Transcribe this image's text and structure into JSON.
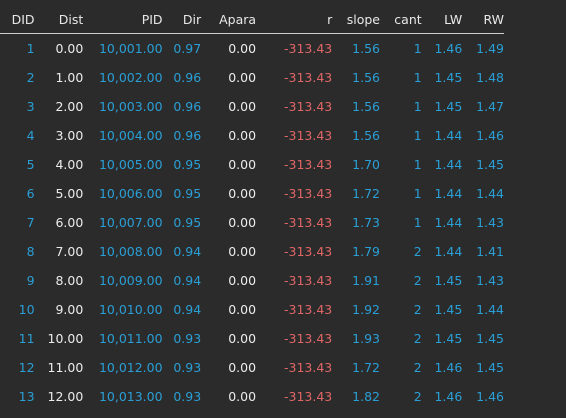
{
  "table": {
    "headers": {
      "did": "DID",
      "dist": "Dist",
      "pid": "PID",
      "dir": "Dir",
      "apara": "Apara",
      "r": "r",
      "slope": "slope",
      "cant": "cant",
      "lw": "LW",
      "rw": "RW"
    },
    "rows": [
      {
        "did": "1",
        "dist": "0.00",
        "pid": "10,001.00",
        "dir": "0.97",
        "apara": "0.00",
        "r": "-313.43",
        "slope": "1.56",
        "cant": "1",
        "lw": "1.46",
        "rw": "1.49"
      },
      {
        "did": "2",
        "dist": "1.00",
        "pid": "10,002.00",
        "dir": "0.96",
        "apara": "0.00",
        "r": "-313.43",
        "slope": "1.56",
        "cant": "1",
        "lw": "1.45",
        "rw": "1.48"
      },
      {
        "did": "3",
        "dist": "2.00",
        "pid": "10,003.00",
        "dir": "0.96",
        "apara": "0.00",
        "r": "-313.43",
        "slope": "1.56",
        "cant": "1",
        "lw": "1.45",
        "rw": "1.47"
      },
      {
        "did": "4",
        "dist": "3.00",
        "pid": "10,004.00",
        "dir": "0.96",
        "apara": "0.00",
        "r": "-313.43",
        "slope": "1.56",
        "cant": "1",
        "lw": "1.44",
        "rw": "1.46"
      },
      {
        "did": "5",
        "dist": "4.00",
        "pid": "10,005.00",
        "dir": "0.95",
        "apara": "0.00",
        "r": "-313.43",
        "slope": "1.70",
        "cant": "1",
        "lw": "1.44",
        "rw": "1.45"
      },
      {
        "did": "6",
        "dist": "5.00",
        "pid": "10,006.00",
        "dir": "0.95",
        "apara": "0.00",
        "r": "-313.43",
        "slope": "1.72",
        "cant": "1",
        "lw": "1.44",
        "rw": "1.44"
      },
      {
        "did": "7",
        "dist": "6.00",
        "pid": "10,007.00",
        "dir": "0.95",
        "apara": "0.00",
        "r": "-313.43",
        "slope": "1.73",
        "cant": "1",
        "lw": "1.44",
        "rw": "1.43"
      },
      {
        "did": "8",
        "dist": "7.00",
        "pid": "10,008.00",
        "dir": "0.94",
        "apara": "0.00",
        "r": "-313.43",
        "slope": "1.79",
        "cant": "2",
        "lw": "1.44",
        "rw": "1.41"
      },
      {
        "did": "9",
        "dist": "8.00",
        "pid": "10,009.00",
        "dir": "0.94",
        "apara": "0.00",
        "r": "-313.43",
        "slope": "1.91",
        "cant": "2",
        "lw": "1.45",
        "rw": "1.43"
      },
      {
        "did": "10",
        "dist": "9.00",
        "pid": "10,010.00",
        "dir": "0.94",
        "apara": "0.00",
        "r": "-313.43",
        "slope": "1.92",
        "cant": "2",
        "lw": "1.45",
        "rw": "1.44"
      },
      {
        "did": "11",
        "dist": "10.00",
        "pid": "10,011.00",
        "dir": "0.93",
        "apara": "0.00",
        "r": "-313.43",
        "slope": "1.93",
        "cant": "2",
        "lw": "1.45",
        "rw": "1.45"
      },
      {
        "did": "12",
        "dist": "11.00",
        "pid": "10,012.00",
        "dir": "0.93",
        "apara": "0.00",
        "r": "-313.43",
        "slope": "1.72",
        "cant": "2",
        "lw": "1.46",
        "rw": "1.45"
      },
      {
        "did": "13",
        "dist": "12.00",
        "pid": "10,013.00",
        "dir": "0.93",
        "apara": "0.00",
        "r": "-313.43",
        "slope": "1.82",
        "cant": "2",
        "lw": "1.46",
        "rw": "1.46"
      }
    ]
  },
  "colors": {
    "background": "#2b2b2b",
    "number_blue": "#2a9fd6",
    "number_white": "#ececec",
    "negative_red": "#e06666",
    "header_rule": "#cfcfcf"
  }
}
